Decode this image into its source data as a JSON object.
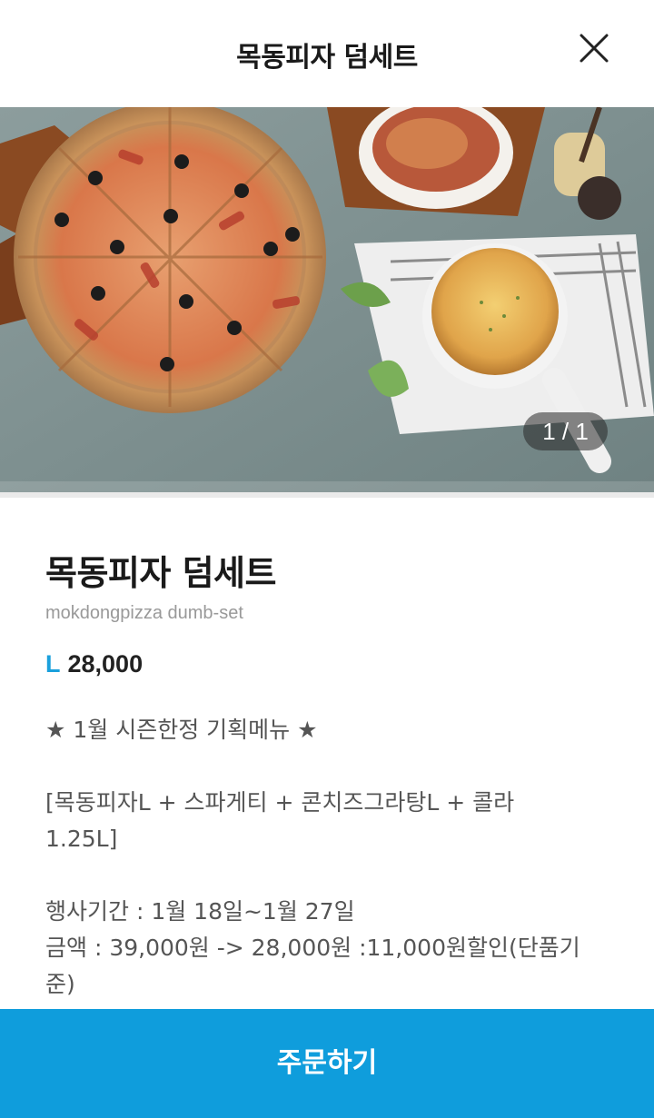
{
  "header": {
    "title": "목동피자 덤세트",
    "close_icon": "close-icon"
  },
  "gallery": {
    "counter": "1 / 1"
  },
  "product": {
    "name": "목동피자 덤세트",
    "english_name": "mokdongpizza dumb-set",
    "size": "L",
    "price": "28,000",
    "description": {
      "headline": "★ 1월 시즌한정 기획메뉴 ★",
      "composition_line1": "[목동피자L + 스파게티 + 콘치즈그라탕L + 콜라",
      "composition_line2": "1.25L]",
      "period": "행사기간 : 1월 18일~1월 27일",
      "amount_line1": "금액 : 39,000원 -> 28,000원 :11,000원할인(단품기",
      "amount_line2": "준)"
    }
  },
  "footer": {
    "order_label": "주문하기"
  },
  "colors": {
    "accent": "#0f9ddc",
    "size_label": "#1aa0dc"
  }
}
